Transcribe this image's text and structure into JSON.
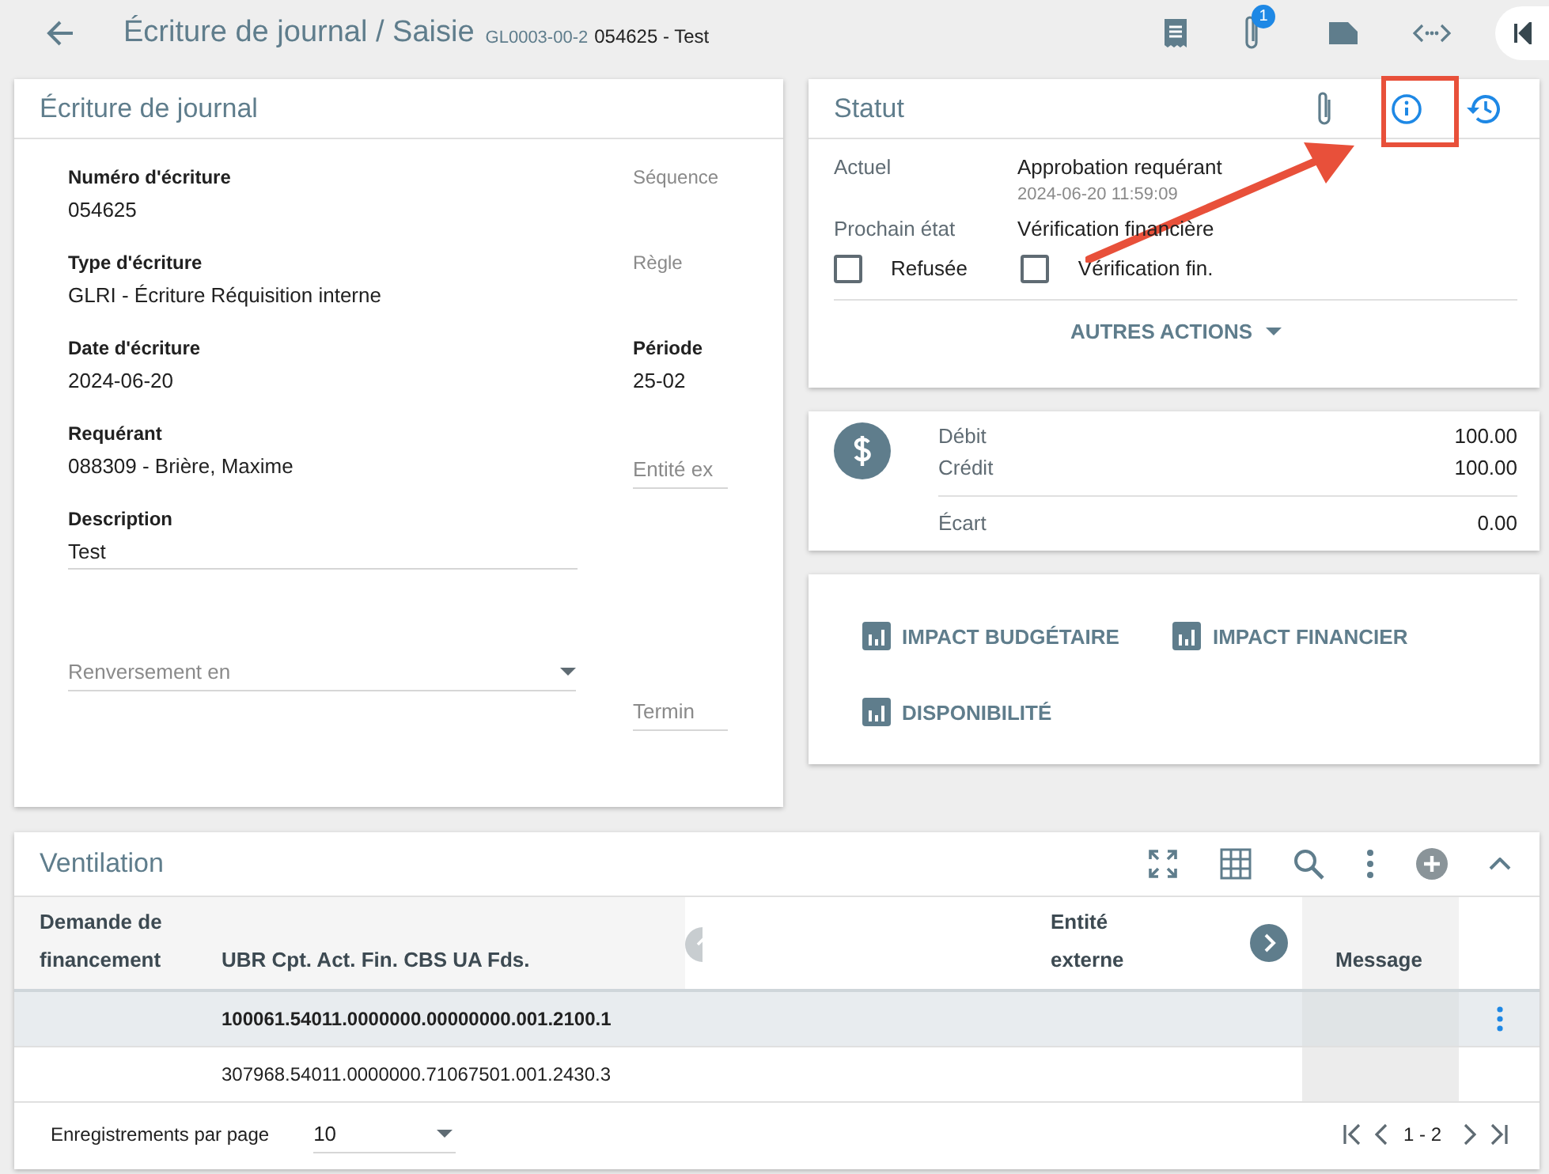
{
  "header": {
    "title": "Écriture de journal / Saisie",
    "code": "GL0003-00-2",
    "subtitle": "054625 - Test",
    "attachment_count": "1"
  },
  "journal_card": {
    "title": "Écriture de journal",
    "rows": [
      {
        "left": {
          "kind": "static",
          "label": "Numéro d'écriture",
          "value": "054625"
        },
        "right": {
          "kind": "hint",
          "label": "Séquence"
        }
      },
      {
        "left": {
          "kind": "static",
          "label": "Type d'écriture",
          "value": "GLRI - Écriture Réquisition interne"
        },
        "right": {
          "kind": "hint",
          "label": "Règle"
        }
      },
      {
        "left": {
          "kind": "static",
          "label": "Date d'écriture",
          "value": "2024-06-20"
        },
        "right": {
          "kind": "static",
          "label": "Période",
          "value": "25-02"
        }
      },
      {
        "left": {
          "kind": "static",
          "label": "Requérant",
          "value": "088309 - Brière, Maxime"
        },
        "right": {
          "kind": "field",
          "label": "Entité ex"
        }
      },
      {
        "left": {
          "kind": "input",
          "label": "Description",
          "value": "Test"
        }
      },
      {
        "left": {
          "kind": "select",
          "label": "Renversement en"
        },
        "right": {
          "kind": "field",
          "label": "Termin"
        }
      }
    ]
  },
  "status_card": {
    "title": "Statut",
    "rows": [
      {
        "label": "Actuel",
        "value": "Approbation requérant",
        "date": "2024-06-20 11:59:09"
      },
      {
        "label": "Prochain état",
        "value": "Vérification financière"
      }
    ],
    "checkboxes": [
      {
        "label": "Refusée",
        "checked": false
      },
      {
        "label": "Vérification fin.",
        "checked": false
      }
    ],
    "action_button": "AUTRES ACTIONS"
  },
  "totals": [
    {
      "label": "Débit",
      "value": "100.00"
    },
    {
      "label": "Crédit",
      "value": "100.00"
    },
    {
      "label": "Écart",
      "value": "0.00"
    }
  ],
  "reports": [
    "IMPACT BUDGÉTAIRE",
    "IMPACT FINANCIER",
    "DISPONIBILITÉ"
  ],
  "ventilation": {
    "title": "Ventilation",
    "columns": [
      "Demande de financement",
      "UBR Cpt. Act. Fin. CBS UA Fds.",
      "Entité externe",
      "Message"
    ],
    "rows": [
      {
        "account": "100061.54011.0000000.00000000.001.2100.1",
        "selected": true
      },
      {
        "account": "307968.54011.0000000.71067501.001.2430.3",
        "selected": false
      }
    ],
    "per_page_label": "Enregistrements par page",
    "per_page": "10",
    "range": "1 - 2"
  }
}
